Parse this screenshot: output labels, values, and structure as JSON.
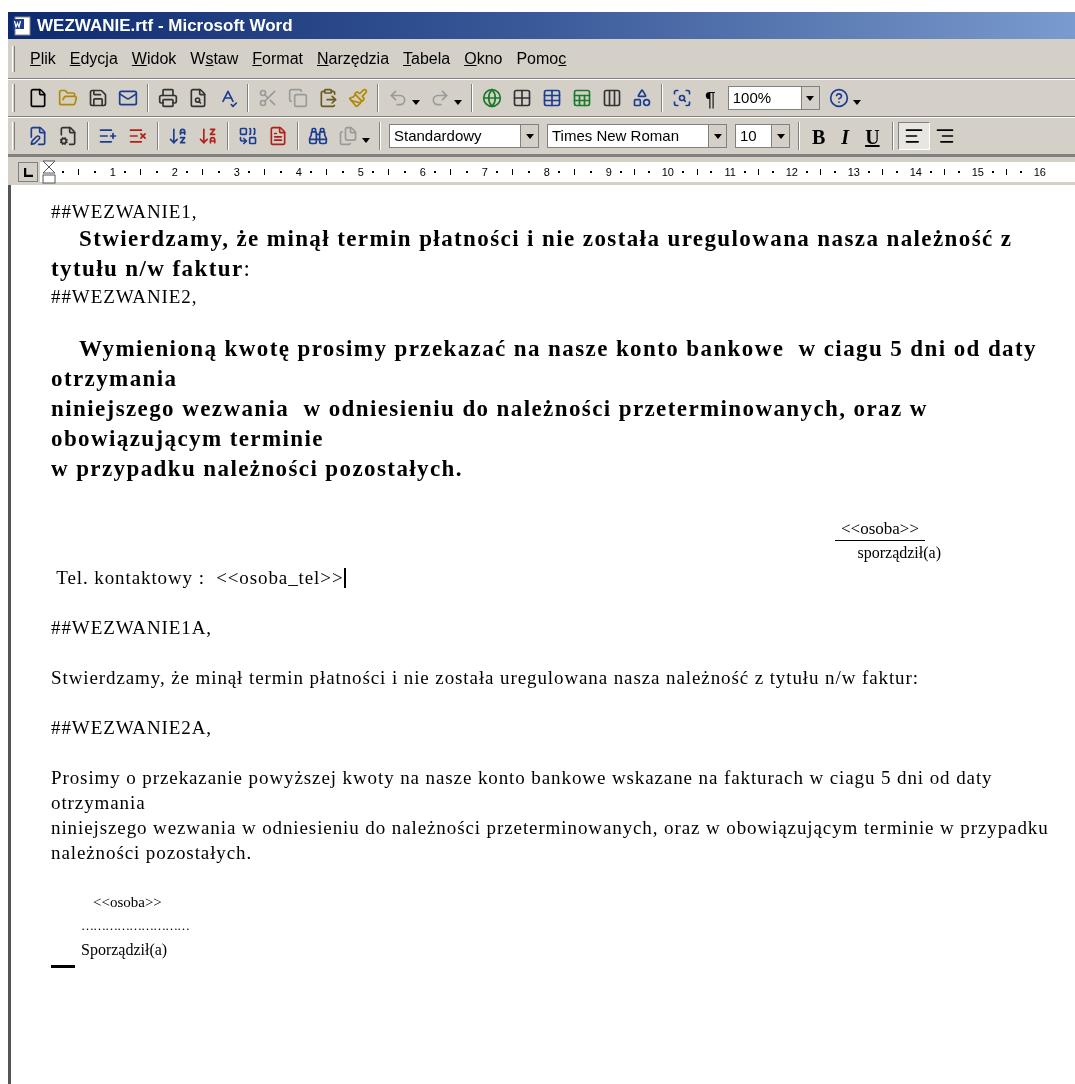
{
  "window": {
    "title": "WEZWANIE.rtf - Microsoft Word"
  },
  "menu": [
    {
      "label": "Plik"
    },
    {
      "label": "Edycja"
    },
    {
      "label": "Widok"
    },
    {
      "label": "Wstaw"
    },
    {
      "label": "Format"
    },
    {
      "label": "Narzędzia"
    },
    {
      "label": "Tabela"
    },
    {
      "label": "Okno"
    },
    {
      "label": "Pomoc"
    }
  ],
  "standard_toolbar": [
    {
      "kind": "button",
      "disabled": false
    },
    {
      "kind": "button",
      "disabled": false
    },
    {
      "kind": "button",
      "disabled": false
    },
    {
      "kind": "button",
      "disabled": false
    },
    {
      "kind": "separator"
    },
    {
      "kind": "button",
      "disabled": false
    },
    {
      "kind": "button",
      "disabled": false
    },
    {
      "kind": "button",
      "disabled": false
    },
    {
      "kind": "separator"
    },
    {
      "kind": "button",
      "disabled": true
    },
    {
      "kind": "button",
      "disabled": true
    },
    {
      "kind": "button",
      "disabled": false
    },
    {
      "kind": "button",
      "disabled": false
    },
    {
      "kind": "separator"
    },
    {
      "kind": "split",
      "disabled": true
    },
    {
      "kind": "split",
      "disabled": true
    },
    {
      "kind": "separator"
    },
    {
      "kind": "button",
      "disabled": false
    },
    {
      "kind": "button",
      "disabled": false
    },
    {
      "kind": "button",
      "disabled": false
    },
    {
      "kind": "button",
      "disabled": false
    },
    {
      "kind": "button",
      "disabled": false
    },
    {
      "kind": "button",
      "disabled": false
    },
    {
      "kind": "separator"
    },
    {
      "kind": "button",
      "disabled": false
    },
    {
      "kind": "glyph",
      "label": "¶"
    },
    {
      "kind": "dropdown",
      "value": "100%"
    },
    {
      "kind": "split",
      "disabled": false
    }
  ],
  "formatting_toolbar": [
    {
      "kind": "button",
      "disabled": false
    },
    {
      "kind": "button",
      "disabled": false
    },
    {
      "kind": "separator"
    },
    {
      "kind": "button",
      "disabled": false
    },
    {
      "kind": "button",
      "disabled": false
    },
    {
      "kind": "separator"
    },
    {
      "kind": "button",
      "disabled": false
    },
    {
      "kind": "button",
      "disabled": false
    },
    {
      "kind": "separator"
    },
    {
      "kind": "button",
      "disabled": false
    },
    {
      "kind": "button",
      "disabled": false
    },
    {
      "kind": "separator"
    },
    {
      "kind": "button",
      "disabled": false
    },
    {
      "kind": "split",
      "disabled": true
    },
    {
      "kind": "separator"
    },
    {
      "kind": "dropdown",
      "value": "Standardowy"
    },
    {
      "kind": "dropdown",
      "value": "Times New Roman"
    },
    {
      "kind": "dropdown",
      "value": "10"
    },
    {
      "kind": "separator"
    },
    {
      "kind": "glyph",
      "label": "B"
    },
    {
      "kind": "glyph",
      "label": "I"
    },
    {
      "kind": "glyph",
      "label": "U"
    },
    {
      "kind": "separator"
    },
    {
      "kind": "align",
      "selected": true
    },
    {
      "kind": "align",
      "selected": false
    }
  ],
  "ruler": {
    "numbers": [
      "1",
      "2",
      "3",
      "4",
      "5",
      "6",
      "7",
      "8",
      "9",
      "10",
      "11",
      "12",
      "13",
      "14",
      "15",
      "16"
    ]
  },
  "document": [
    {
      "kind": "plain",
      "text": "##WEZWANIE1,"
    },
    {
      "kind": "bold",
      "text": "**Stwierdzamy, że minął termin płatności i nie została uregulowana nasza należność z tytułu n/w faktur**:"
    },
    {
      "kind": "plain",
      "text": "##WEZWANIE2,"
    },
    {
      "kind": "blank"
    },
    {
      "kind": "bold",
      "text": "Wymienioną kwotę prosimy przekazać na nasze konto bankowe  w ciagu 5 dni od daty otrzymania"
    },
    {
      "kind": "bold_flat",
      "text": "niniejszego wezwania  w odniesieniu do należności przeterminowanych, oraz w obowiązującym terminie"
    },
    {
      "kind": "bold_flat",
      "text": "w przypadku należności pozostałych."
    },
    {
      "kind": "signature_right",
      "name": "<<osoba>>",
      "caption": "sporządził(a)"
    },
    {
      "kind": "tel",
      "text": " Tel. kontaktowy :  <<osoba_tel>>"
    },
    {
      "kind": "blank"
    },
    {
      "kind": "plain",
      "text": "##WEZWANIE1A,"
    },
    {
      "kind": "blank"
    },
    {
      "kind": "plain",
      "text": "Stwierdzamy, że minął termin płatności i nie została uregulowana nasza należność z tytułu n/w faktur:"
    },
    {
      "kind": "blank"
    },
    {
      "kind": "plain",
      "text": "##WEZWANIE2A,"
    },
    {
      "kind": "blank"
    },
    {
      "kind": "plain",
      "text": "Prosimy o przekazanie powyższej kwoty na nasze konto bankowe wskazane na fakturach w ciagu 5 dni od daty otrzymania"
    },
    {
      "kind": "plain",
      "text": "niniejszego wezwania w odniesieniu do należności przeterminowanych, oraz w obowiązującym terminie w przypadku należności pozostałych."
    },
    {
      "kind": "blank"
    },
    {
      "kind": "signature_left",
      "name": "<<osoba>>",
      "dots": "………………………",
      "caption": "Sporządził(a)"
    }
  ]
}
